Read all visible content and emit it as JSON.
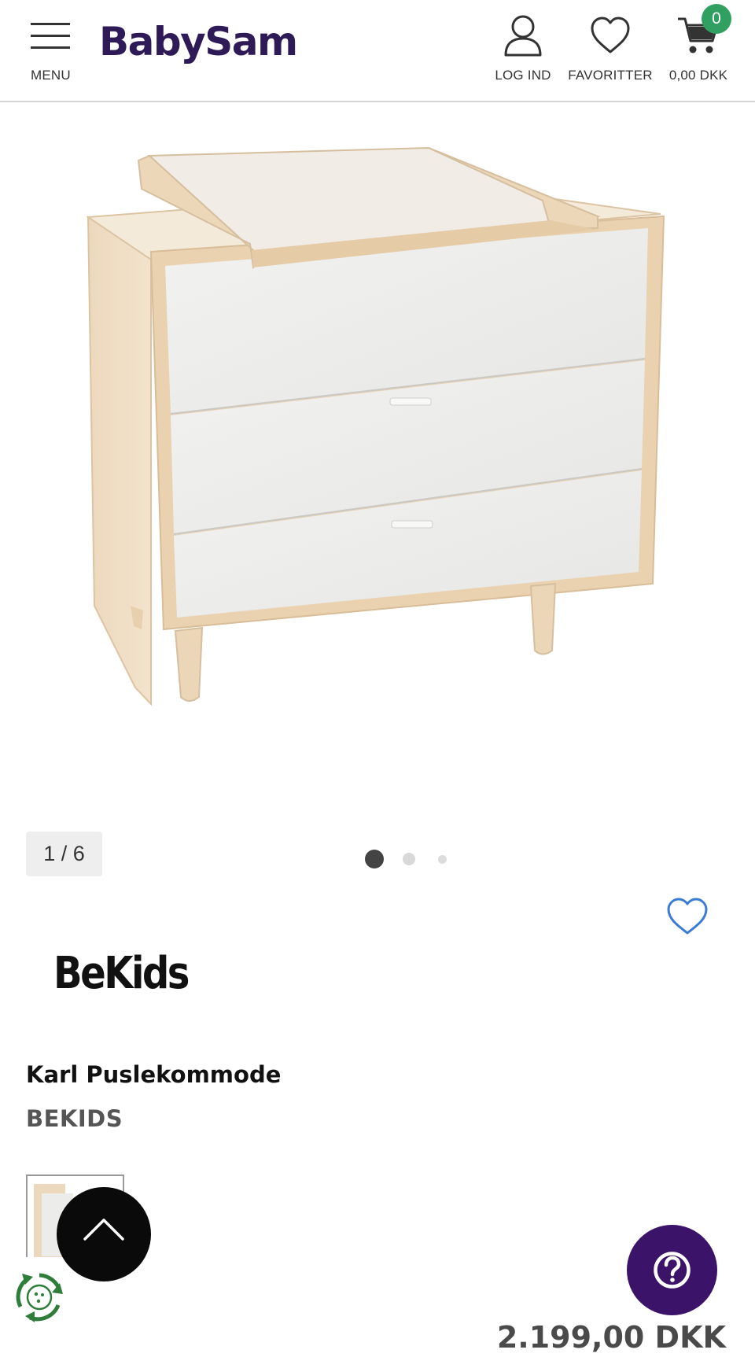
{
  "header": {
    "menu_label": "MENU",
    "logo_text": "BabySam",
    "login_label": "LOG IND",
    "favorites_label": "FAVORITTER",
    "cart_total": "0,00 DKK",
    "cart_count": "0",
    "badge_color": "#2fa05f",
    "logo_color": "#2e1a57"
  },
  "gallery": {
    "counter": "1 / 6",
    "dots_total": 3,
    "active_dot": 0
  },
  "product": {
    "brand_logo": "BeKids",
    "title": "Karl Puslekommode",
    "brand": "BEKIDS",
    "price": "2.199,00 DKK"
  },
  "icons": {
    "wishlist": "heart-outline-icon",
    "scroll_top": "chevron-up-icon",
    "help": "question-circle-icon",
    "eco": "recycle-icon"
  },
  "colors": {
    "help_button": "#3b1469",
    "wishlist_heart": "#3a7bd5"
  }
}
